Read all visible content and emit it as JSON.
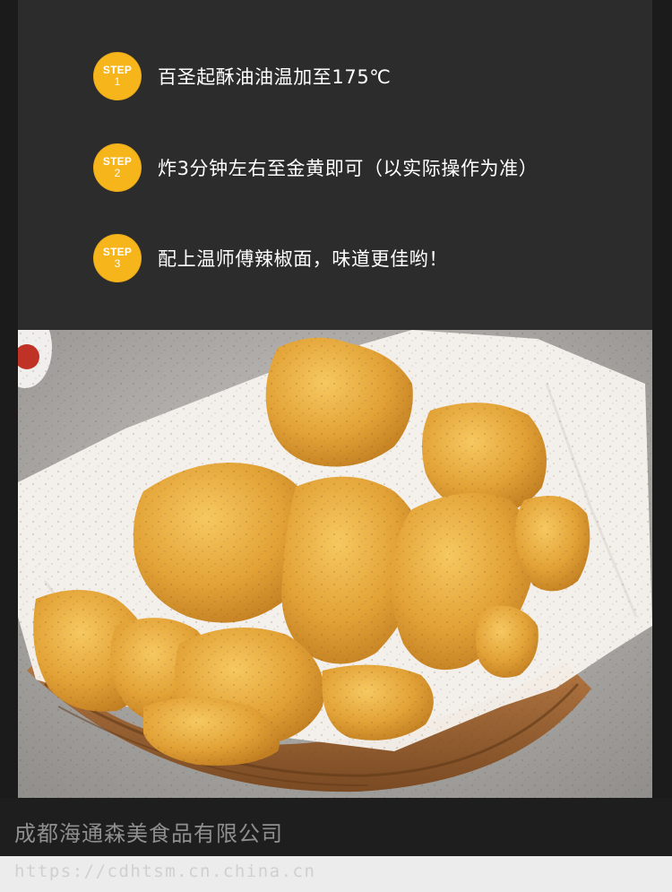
{
  "steps": [
    {
      "badge_label": "STEP",
      "badge_number": "1",
      "text": "百圣起酥油油温加至175℃"
    },
    {
      "badge_label": "STEP",
      "badge_number": "2",
      "text": "炸3分钟左右至金黄即可（以实际操作为准）"
    },
    {
      "badge_label": "STEP",
      "badge_number": "3",
      "text": "配上温师傅辣椒面，味道更佳哟！"
    }
  ],
  "footer": {
    "company": "成都海通森美食品有限公司",
    "url": "https://cdhtsm.cn.china.cn"
  },
  "colors": {
    "panel_bg": "#2c2c2c",
    "page_bg": "#1b1b1b",
    "badge": "#f7b51c",
    "nugget": "#e7a73a"
  }
}
